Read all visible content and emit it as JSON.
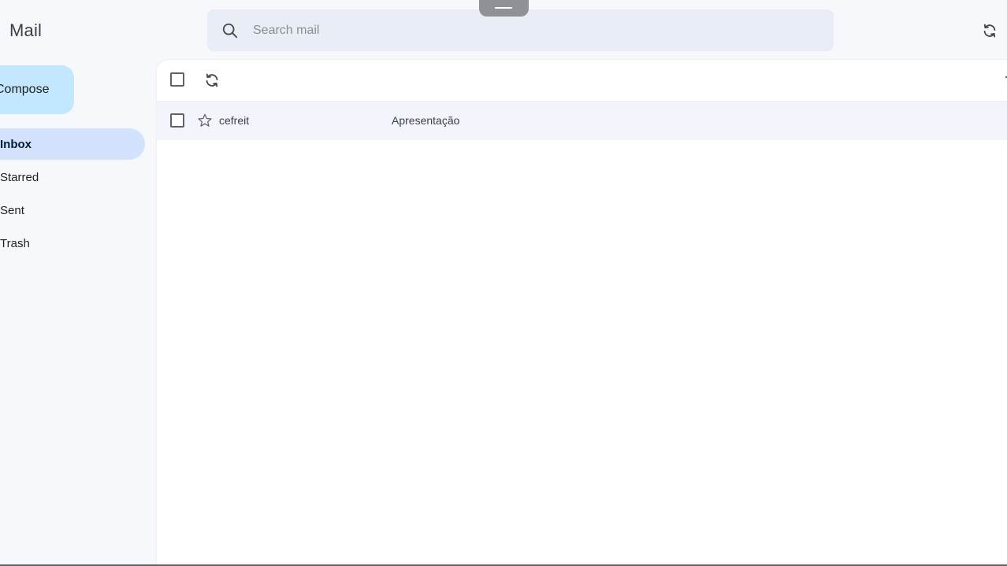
{
  "app": {
    "title": "Mail"
  },
  "search": {
    "placeholder": "Search mail",
    "value": ""
  },
  "sidebar": {
    "compose_label": "Compose",
    "items": [
      {
        "label": "Inbox",
        "active": true
      },
      {
        "label": "Starred",
        "active": false
      },
      {
        "label": "Sent",
        "active": false
      },
      {
        "label": "Trash",
        "active": false
      }
    ]
  },
  "emails": [
    {
      "sender": "cefreit",
      "subject": "Apresentação",
      "starred": false
    }
  ],
  "icons": {
    "search": "search-icon",
    "refresh": "refresh-icon",
    "star": "star-outline-icon",
    "handle": "drag-handle-icon"
  },
  "colors": {
    "background": "#f6f8fc",
    "search_bg": "#e9eef6",
    "compose_bg": "#c2e7ff",
    "active_nav_bg": "#d3e3fd",
    "row_bg": "#f2f6fc",
    "panel_bg": "#ffffff"
  }
}
